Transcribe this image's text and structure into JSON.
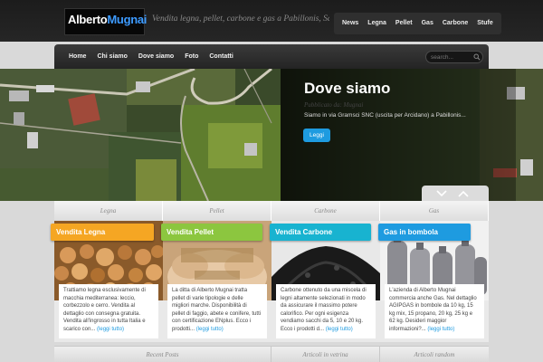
{
  "header": {
    "logo_part1": "Alberto",
    "logo_part2": "Mugnai",
    "tagline": "Vendita legna, pellet, carbone e gas a Pabillonis, Sardegna",
    "top_nav": [
      "News",
      "Legna",
      "Pellet",
      "Gas",
      "Carbone",
      "Stufe"
    ]
  },
  "main_nav": [
    "Home",
    "Chi siamo",
    "Dove siamo",
    "Foto",
    "Contatti"
  ],
  "search": {
    "placeholder": "search..."
  },
  "hero": {
    "title": "Dove siamo",
    "subtitle": "Pubblicato da: Mugnai",
    "text": "Siamo in via Gramsci SNC (uscita per Arcidano) a Pabillonis...",
    "button": "Leggi"
  },
  "tabs": [
    "Legna",
    "Pellet",
    "Carbone",
    "Gas"
  ],
  "products": [
    {
      "title": "Vendita Legna",
      "color": "#f5a623",
      "lines": [
        "Trattiamo legna esclusivamente di",
        "macchia mediterranea: leccio,",
        "corbezzolo e cerro. Vendita al",
        "dettaglio con consegna gratuita.",
        "Vendita all'ingrosso in tutta Italia e",
        "scarico con..."
      ],
      "more": "(leggi tutto)"
    },
    {
      "title": "Vendita Pellet",
      "color": "#8cc63f",
      "lines": [
        "La ditta di Alberto Mugnai tratta",
        "pellet di varie tipologie e delle",
        "migliori marche. Disponibilità di",
        "pellet di faggio, abete e conifere, tutti",
        "con certificazione ENplus. Ecco i",
        "prodotti..."
      ],
      "more": "(leggi tutto)"
    },
    {
      "title": "Vendita Carbone",
      "color": "#18b3d0",
      "lines": [
        "Carbone ottenuto da una miscela di",
        "legni altamente selezionati in modo",
        "da assicurare il massimo potere",
        "calorifico. Per ogni esigenza",
        "vendiamo sacchi da 5, 10 e 20 kg.",
        "Ecco i prodotti d..."
      ],
      "more": "(leggi tutto)"
    },
    {
      "title": "Gas in bombola",
      "color": "#1e9be0",
      "lines": [
        "L'azienda di Alberto Mugnai",
        "commercia anche Gas. Nel dettaglio",
        "AGIPGAS in bombole da 10 kg, 15",
        "kg mix, 15 propano, 20 kg, 25 kg e",
        "62 kg.    Desideri maggior",
        "informazioni?..."
      ],
      "more": "(leggi tutto)"
    }
  ],
  "bottom_tabs": [
    "Recent Posts",
    "Articoli in vetrina",
    "Articoli random"
  ]
}
